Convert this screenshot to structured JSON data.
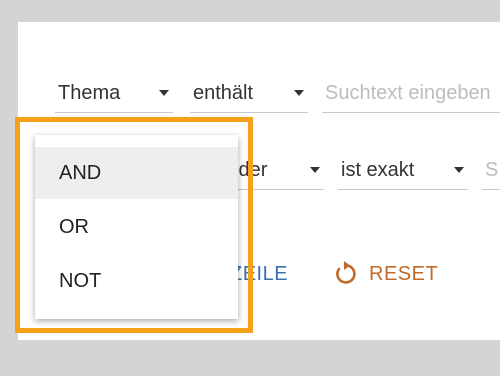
{
  "filter_rows": [
    {
      "field": "Thema",
      "operator": "enthält",
      "placeholder": "Suchtext eingeben"
    },
    {
      "field_partial": "lder",
      "operator": "ist exakt",
      "placeholder_partial": "S"
    }
  ],
  "actions": {
    "add_row_partial": "ZEILE",
    "reset": "RESET"
  },
  "logic_menu": {
    "items": [
      "AND",
      "OR",
      "NOT"
    ],
    "highlighted": "AND"
  },
  "colors": {
    "highlight_border": "#f7a11a",
    "reset": "#c0692a",
    "add_row": "#3a6fb0"
  },
  "icons": {
    "reset": "reset-icon",
    "dropdown": "chevron-down-icon"
  }
}
